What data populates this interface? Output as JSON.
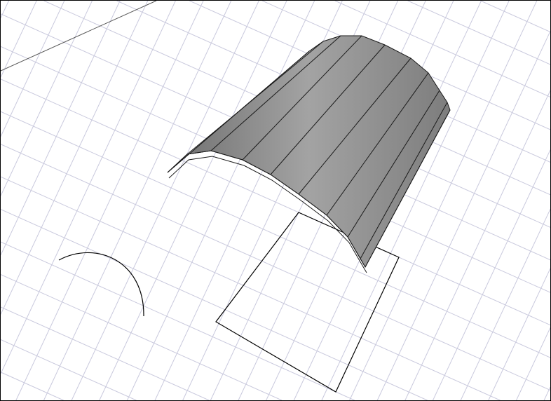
{
  "viewport": {
    "background": "#ffffff",
    "grid_color": "#c9c9dd",
    "axis_color": "#555555",
    "model_fill": "#8e8e8e",
    "model_edge": "#1a1a1a",
    "sketch_color": "#000000"
  }
}
